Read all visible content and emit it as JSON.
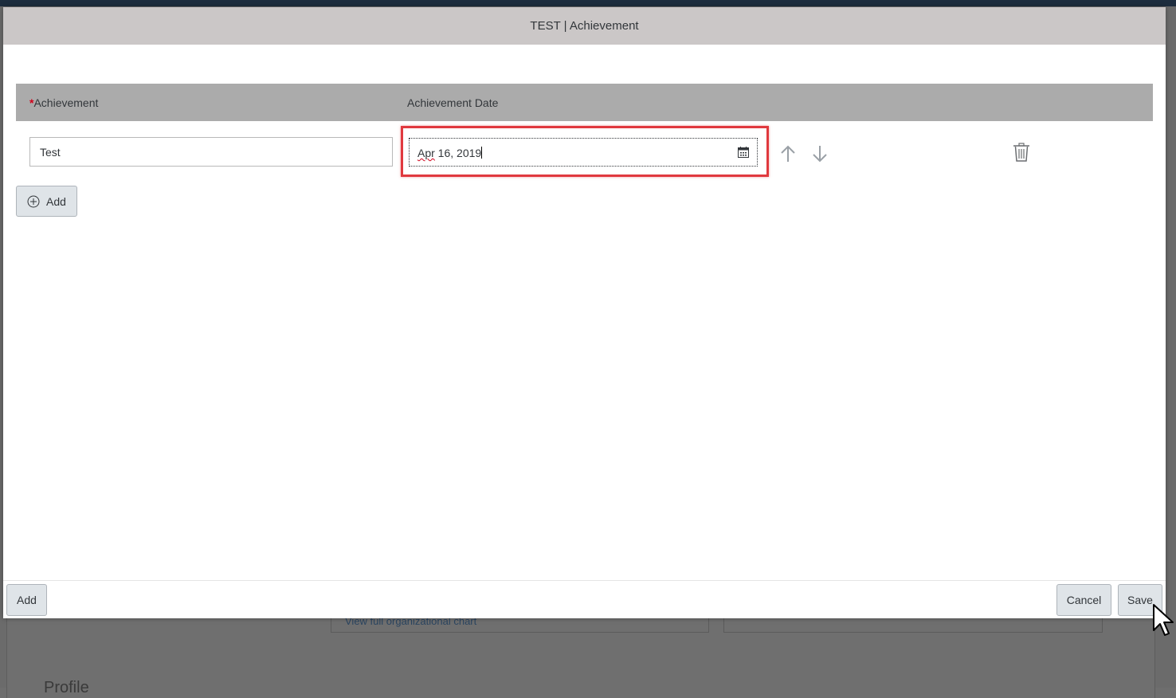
{
  "dialog": {
    "title": "TEST | Achievement"
  },
  "table": {
    "columns": [
      {
        "label": "Achievement",
        "required": true,
        "required_marker": "*"
      },
      {
        "label": "Achievement Date",
        "required": false
      }
    ],
    "rows": [
      {
        "achievement_value": "Test",
        "date_value_misspelled": "Apr",
        "date_value_rest": " 16, 2019"
      }
    ],
    "add_label": "Add"
  },
  "footer": {
    "add_label": "Add",
    "cancel_label": "Cancel",
    "save_label": "Save"
  },
  "background": {
    "link_text": "View full organizational chart",
    "section_title": "Profile"
  },
  "icons": {
    "add_row": "plus-circle-icon",
    "date": "calendar-icon",
    "move_up": "arrow-up-icon",
    "move_down": "arrow-down-icon",
    "delete": "trash-icon"
  },
  "colors": {
    "header_bar": "#cbc7c7",
    "table_header": "#ababab",
    "focus_highlight": "#e0393e",
    "required_asterisk": "#d0021b",
    "button_bg": "#dfe4e8"
  }
}
